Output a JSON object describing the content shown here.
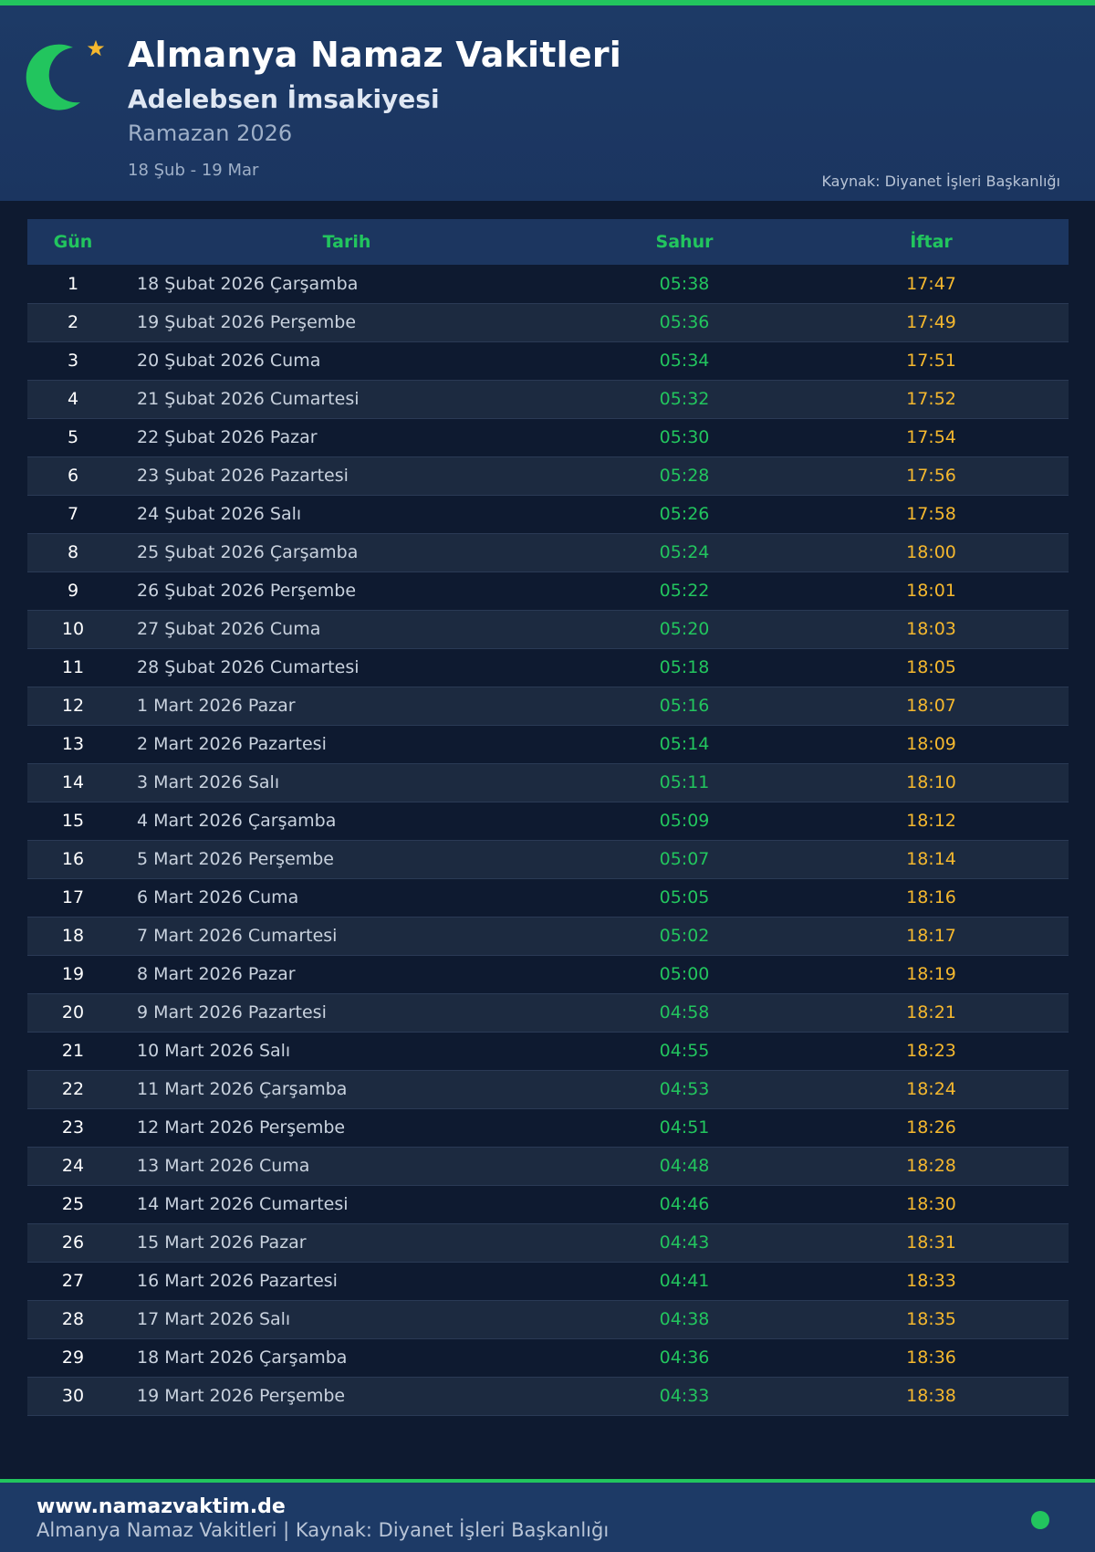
{
  "colors": {
    "accent_green": "#22c55e",
    "accent_yellow": "#f5b82e",
    "header_bg": "#1d3a66",
    "page_bg": "#0e1a30"
  },
  "header": {
    "icon": "crescent-star-icon",
    "title": "Almanya Namaz Vakitleri",
    "subtitle": "Adelebsen İmsakiyesi",
    "ramazan": "Ramazan 2026",
    "range": "18 Şub - 19 Mar",
    "source": "Kaynak: Diyanet İşleri Başkanlığı"
  },
  "table": {
    "headers": [
      "Gün",
      "Tarih",
      "Sahur",
      "İftar"
    ],
    "rows": [
      {
        "gun": "1",
        "tarih": "18 Şubat 2026 Çarşamba",
        "sahur": "05:38",
        "iftar": "17:47"
      },
      {
        "gun": "2",
        "tarih": "19 Şubat 2026 Perşembe",
        "sahur": "05:36",
        "iftar": "17:49"
      },
      {
        "gun": "3",
        "tarih": "20 Şubat 2026 Cuma",
        "sahur": "05:34",
        "iftar": "17:51"
      },
      {
        "gun": "4",
        "tarih": "21 Şubat 2026 Cumartesi",
        "sahur": "05:32",
        "iftar": "17:52"
      },
      {
        "gun": "5",
        "tarih": "22 Şubat 2026 Pazar",
        "sahur": "05:30",
        "iftar": "17:54"
      },
      {
        "gun": "6",
        "tarih": "23 Şubat 2026 Pazartesi",
        "sahur": "05:28",
        "iftar": "17:56"
      },
      {
        "gun": "7",
        "tarih": "24 Şubat 2026 Salı",
        "sahur": "05:26",
        "iftar": "17:58"
      },
      {
        "gun": "8",
        "tarih": "25 Şubat 2026 Çarşamba",
        "sahur": "05:24",
        "iftar": "18:00"
      },
      {
        "gun": "9",
        "tarih": "26 Şubat 2026 Perşembe",
        "sahur": "05:22",
        "iftar": "18:01"
      },
      {
        "gun": "10",
        "tarih": "27 Şubat 2026 Cuma",
        "sahur": "05:20",
        "iftar": "18:03"
      },
      {
        "gun": "11",
        "tarih": "28 Şubat 2026 Cumartesi",
        "sahur": "05:18",
        "iftar": "18:05"
      },
      {
        "gun": "12",
        "tarih": "1 Mart 2026 Pazar",
        "sahur": "05:16",
        "iftar": "18:07"
      },
      {
        "gun": "13",
        "tarih": "2 Mart 2026 Pazartesi",
        "sahur": "05:14",
        "iftar": "18:09"
      },
      {
        "gun": "14",
        "tarih": "3 Mart 2026 Salı",
        "sahur": "05:11",
        "iftar": "18:10"
      },
      {
        "gun": "15",
        "tarih": "4 Mart 2026 Çarşamba",
        "sahur": "05:09",
        "iftar": "18:12"
      },
      {
        "gun": "16",
        "tarih": "5 Mart 2026 Perşembe",
        "sahur": "05:07",
        "iftar": "18:14"
      },
      {
        "gun": "17",
        "tarih": "6 Mart 2026 Cuma",
        "sahur": "05:05",
        "iftar": "18:16"
      },
      {
        "gun": "18",
        "tarih": "7 Mart 2026 Cumartesi",
        "sahur": "05:02",
        "iftar": "18:17"
      },
      {
        "gun": "19",
        "tarih": "8 Mart 2026 Pazar",
        "sahur": "05:00",
        "iftar": "18:19"
      },
      {
        "gun": "20",
        "tarih": "9 Mart 2026 Pazartesi",
        "sahur": "04:58",
        "iftar": "18:21"
      },
      {
        "gun": "21",
        "tarih": "10 Mart 2026 Salı",
        "sahur": "04:55",
        "iftar": "18:23"
      },
      {
        "gun": "22",
        "tarih": "11 Mart 2026 Çarşamba",
        "sahur": "04:53",
        "iftar": "18:24"
      },
      {
        "gun": "23",
        "tarih": "12 Mart 2026 Perşembe",
        "sahur": "04:51",
        "iftar": "18:26"
      },
      {
        "gun": "24",
        "tarih": "13 Mart 2026 Cuma",
        "sahur": "04:48",
        "iftar": "18:28"
      },
      {
        "gun": "25",
        "tarih": "14 Mart 2026 Cumartesi",
        "sahur": "04:46",
        "iftar": "18:30"
      },
      {
        "gun": "26",
        "tarih": "15 Mart 2026 Pazar",
        "sahur": "04:43",
        "iftar": "18:31"
      },
      {
        "gun": "27",
        "tarih": "16 Mart 2026 Pazartesi",
        "sahur": "04:41",
        "iftar": "18:33"
      },
      {
        "gun": "28",
        "tarih": "17 Mart 2026 Salı",
        "sahur": "04:38",
        "iftar": "18:35"
      },
      {
        "gun": "29",
        "tarih": "18 Mart 2026 Çarşamba",
        "sahur": "04:36",
        "iftar": "18:36"
      },
      {
        "gun": "30",
        "tarih": "19 Mart 2026 Perşembe",
        "sahur": "04:33",
        "iftar": "18:38"
      }
    ]
  },
  "footer": {
    "site": "www.namazvaktim.de",
    "info": "Almanya Namaz Vakitleri | Kaynak: Diyanet İşleri Başkanlığı",
    "indicator": "status-dot-icon"
  }
}
